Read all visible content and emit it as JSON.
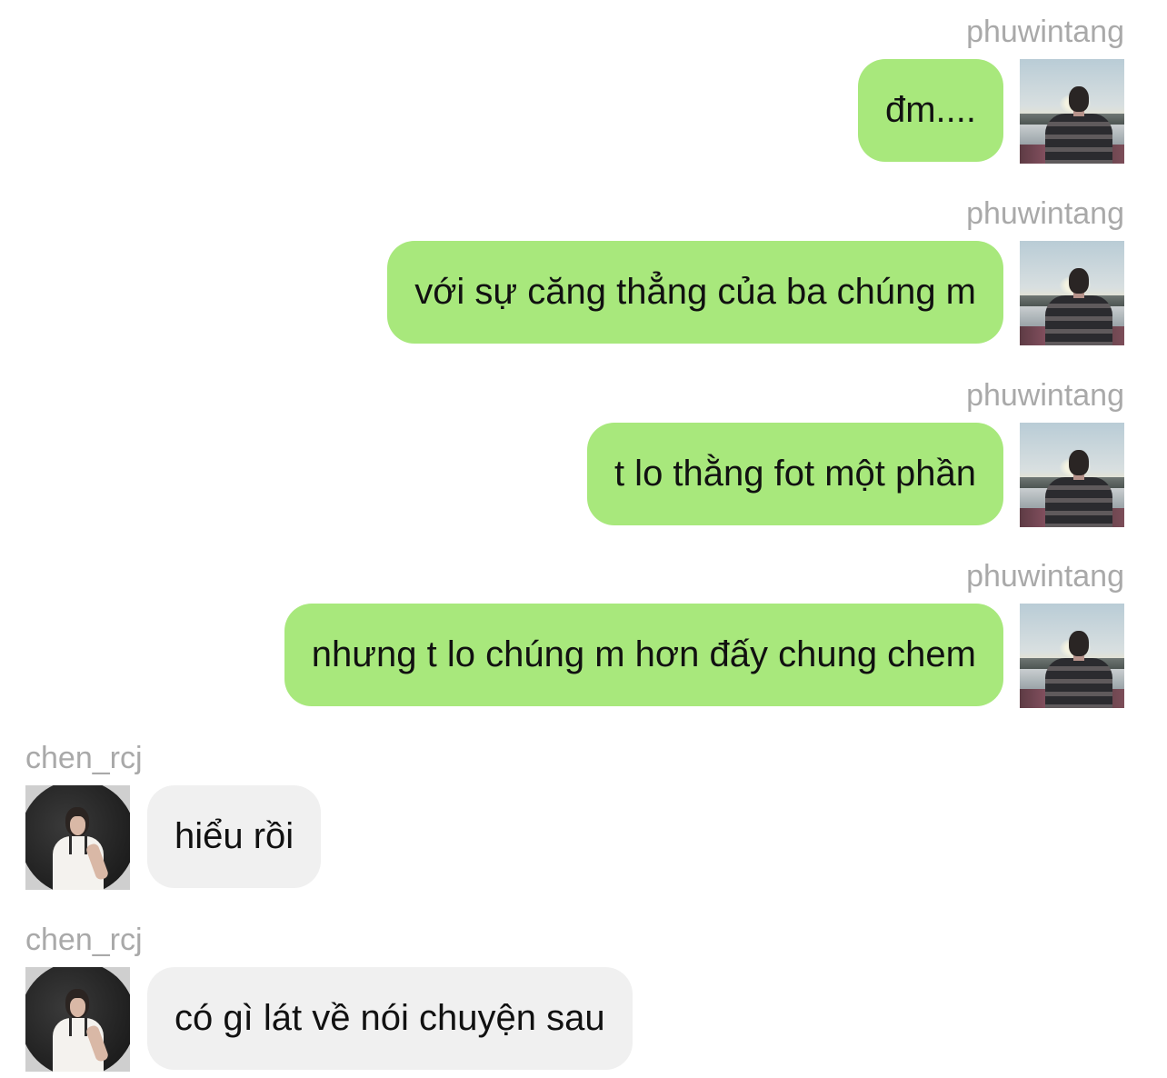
{
  "messages": [
    {
      "direction": "out",
      "sender": "phuwintang",
      "text": "đm...."
    },
    {
      "direction": "out",
      "sender": "phuwintang",
      "text": "với sự căng thẳng của ba chúng m"
    },
    {
      "direction": "out",
      "sender": "phuwintang",
      "text": "t lo thằng fot một phần"
    },
    {
      "direction": "out",
      "sender": "phuwintang",
      "text": "nhưng t lo chúng m hơn đấy chung chem"
    },
    {
      "direction": "in",
      "sender": "chen_rcj",
      "text": "hiểu rồi"
    },
    {
      "direction": "in",
      "sender": "chen_rcj",
      "text": "có gì lát về nói chuyện sau"
    }
  ],
  "colors": {
    "outgoing_bubble": "#a8e87c",
    "incoming_bubble": "#f0f0f0",
    "sender_name": "#a9a9a9",
    "message_text": "#111111"
  }
}
